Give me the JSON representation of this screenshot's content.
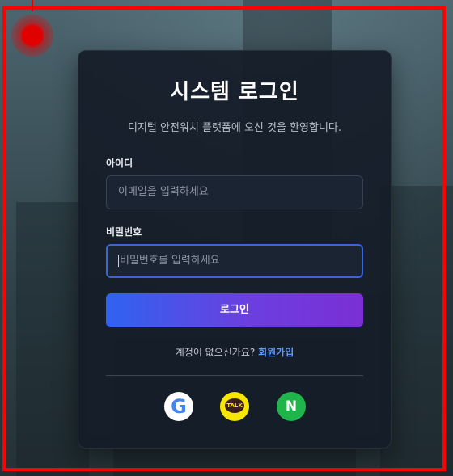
{
  "login": {
    "title": "시스템 로그인",
    "subtitle": "디지털 안전워치 플랫폼에 오신 것을 환영합니다.",
    "id_label": "아이디",
    "id_placeholder": "이메일을 입력하세요",
    "password_label": "비밀번호",
    "password_placeholder": "비밀번호를 입력하세요",
    "submit_label": "로그인",
    "signup_prompt": "계정이 없으신가요?",
    "signup_link": "회원가입"
  },
  "social": {
    "google": {
      "icon": "google-icon",
      "glyph": "G"
    },
    "kakao": {
      "icon": "kakao-talk-icon",
      "glyph": "TALK"
    },
    "naver": {
      "icon": "naver-icon",
      "glyph": "N"
    }
  },
  "colors": {
    "accent_start": "#2f63f0",
    "accent_end": "#7a2fd4",
    "link": "#5e9bff",
    "highlight_frame": "#ff0000"
  }
}
